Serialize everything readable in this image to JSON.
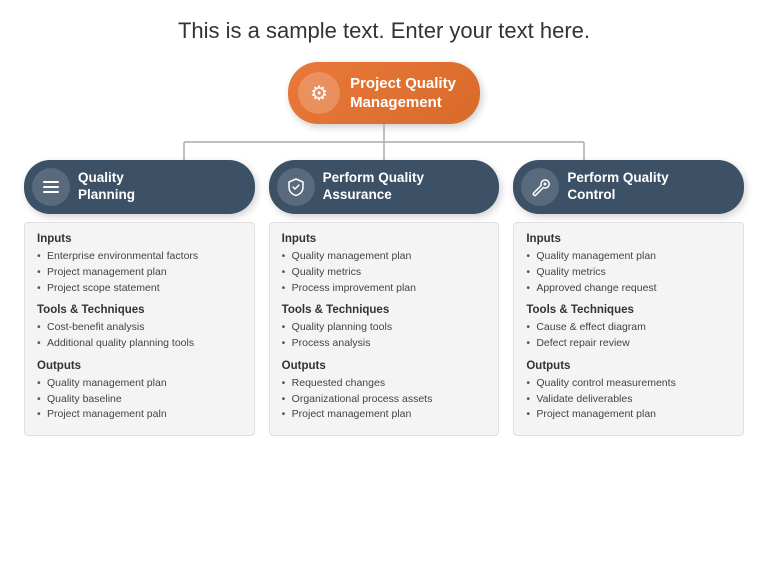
{
  "header": {
    "sample_text": "This is a sample text. Enter your text here."
  },
  "top_node": {
    "icon": "⚙",
    "label_line1": "Project Quality",
    "label_line2": "Management"
  },
  "columns": [
    {
      "id": "quality-planning",
      "icon": "☰",
      "header_line1": "Quality",
      "header_line2": "Planning",
      "sections": [
        {
          "title": "Inputs",
          "items": [
            "Enterprise environmental factors",
            "Project management plan",
            "Project scope statement"
          ]
        },
        {
          "title": "Tools & Techniques",
          "items": [
            "Cost-benefit analysis",
            "Additional quality planning tools"
          ]
        },
        {
          "title": "Outputs",
          "items": [
            "Quality management plan",
            "Quality baseline",
            "Project management paln"
          ]
        }
      ]
    },
    {
      "id": "perform-quality-assurance",
      "icon": "🛡",
      "header_line1": "Perform Quality",
      "header_line2": "Assurance",
      "sections": [
        {
          "title": "Inputs",
          "items": [
            "Quality management plan",
            "Quality metrics",
            "Process improvement plan"
          ]
        },
        {
          "title": "Tools & Techniques",
          "items": [
            "Quality planning tools",
            "Process analysis"
          ]
        },
        {
          "title": "Outputs",
          "items": [
            "Requested changes",
            "Organizational process assets",
            "Project management plan"
          ]
        }
      ]
    },
    {
      "id": "perform-quality-control",
      "icon": "🔧",
      "header_line1": "Perform Quality",
      "header_line2": "Control",
      "sections": [
        {
          "title": "Inputs",
          "items": [
            "Quality management plan",
            "Quality metrics",
            "Approved change request"
          ]
        },
        {
          "title": "Tools & Techniques",
          "items": [
            "Cause & effect diagram",
            "Defect repair review"
          ]
        },
        {
          "title": "Outputs",
          "items": [
            "Quality control measurements",
            "Validate deliverables",
            "Project management plan"
          ]
        }
      ]
    }
  ]
}
